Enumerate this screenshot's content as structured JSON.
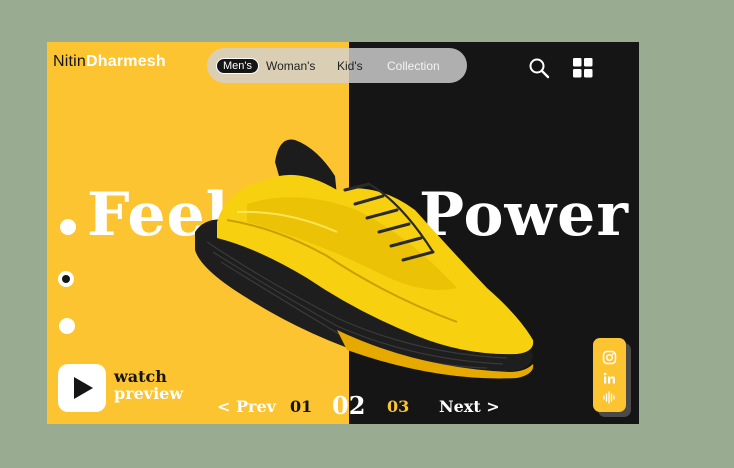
{
  "brand": {
    "first": "Nitin",
    "second": "Dharmesh"
  },
  "nav": [
    {
      "label": "Men's",
      "active": true
    },
    {
      "label": "Woman's",
      "active": false
    },
    {
      "label": "Kid's",
      "active": false
    },
    {
      "label": "Collection",
      "active": false
    }
  ],
  "header_icons": [
    "search-icon",
    "grid-menu-icon"
  ],
  "hero": {
    "headline_left": "Feel",
    "headline_right": "Power",
    "product_image": "yellow-running-shoe"
  },
  "slide_dots": {
    "count": 3,
    "active_index": 1
  },
  "watch": {
    "line1": "watch",
    "line2": "preview",
    "icon": "play-icon"
  },
  "pager": {
    "prev": "< Prev",
    "pages": [
      "01",
      "02",
      "03"
    ],
    "current": "02",
    "next": "Next >"
  },
  "social": [
    "instagram-icon",
    "linkedin-icon",
    "audio-wave-icon"
  ],
  "colors": {
    "accent_yellow": "#fdc432",
    "dark": "#151515",
    "background": "#99ab91",
    "white": "#ffffff"
  }
}
